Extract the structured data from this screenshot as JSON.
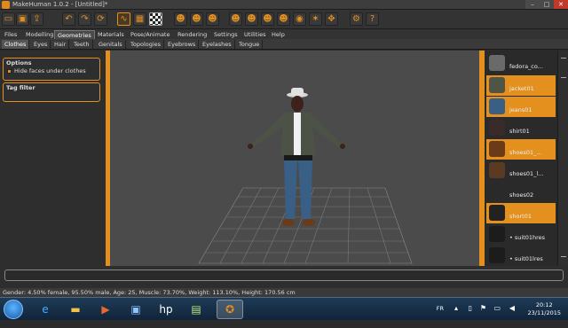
{
  "window": {
    "title": "MakeHuman 1.0.2 - [Untitled]*",
    "minimize": "–",
    "maximize": "□",
    "close": "✕"
  },
  "toolbar": {
    "icons": [
      {
        "name": "undo-icon",
        "glyph": "↶"
      },
      {
        "name": "redo-icon",
        "glyph": "↷"
      },
      {
        "name": "reset-icon",
        "glyph": "⟳"
      },
      {
        "name": "smooth-icon",
        "glyph": "∿"
      },
      {
        "name": "wireframe-icon",
        "glyph": "▦"
      },
      {
        "name": "background-checker-icon",
        "glyph": ""
      },
      {
        "name": "front-view-icon",
        "glyph": "☻"
      },
      {
        "name": "back-view-icon",
        "glyph": "☻"
      },
      {
        "name": "left-view-icon",
        "glyph": "☻"
      },
      {
        "name": "right-view-icon",
        "glyph": "☻"
      },
      {
        "name": "top-view-icon",
        "glyph": "☻"
      },
      {
        "name": "bottom-view-icon",
        "glyph": "☻"
      },
      {
        "name": "reset-camera-icon",
        "glyph": "✥"
      },
      {
        "name": "save-icon",
        "glyph": "▣"
      },
      {
        "name": "load-icon",
        "glyph": "▤"
      },
      {
        "name": "export-icon",
        "glyph": "⇪"
      },
      {
        "name": "screenshot-icon",
        "glyph": "◉"
      },
      {
        "name": "pose-icon",
        "glyph": "☼"
      },
      {
        "name": "skeleton-icon",
        "glyph": "✶"
      },
      {
        "name": "settings-icon",
        "glyph": "⚙"
      },
      {
        "name": "help-icon",
        "glyph": "?"
      }
    ]
  },
  "menu": {
    "tabs": [
      "Files",
      "Modelling",
      "Geometries",
      "Materials",
      "Pose/Animate",
      "Rendering",
      "Settings",
      "Utilities",
      "Help"
    ],
    "active": "Geometries"
  },
  "submenu": {
    "tabs": [
      "Clothes",
      "Eyes",
      "Hair",
      "Teeth",
      "Genitals",
      "Topologies",
      "Eyebrows",
      "Eyelashes",
      "Tongue"
    ],
    "active": "Clothes"
  },
  "left": {
    "options_title": "Options",
    "hide_faces_label": "Hide faces under clothes",
    "tag_filter_title": "Tag filter"
  },
  "clothes": {
    "items": [
      {
        "label": "fedora_co...",
        "selected": false,
        "color": "#6a6a6a"
      },
      {
        "label": "jacket01",
        "selected": true,
        "color": "#4f5546"
      },
      {
        "label": "jeans01",
        "selected": true,
        "color": "#3a5f86"
      },
      {
        "label": "shirt01",
        "selected": false,
        "color": "#3b2a2a"
      },
      {
        "label": "shoes01_...",
        "selected": true,
        "color": "#6b3a18"
      },
      {
        "label": "shoes01_l...",
        "selected": false,
        "color": "#5a3a22"
      },
      {
        "label": "shoes02",
        "selected": false,
        "color": "#2a2a2a"
      },
      {
        "label": "short01",
        "selected": true,
        "color": "#222222"
      },
      {
        "label": "• suit01hres",
        "selected": false,
        "color": "#1c1c1c"
      },
      {
        "label": "• suit01lres",
        "selected": false,
        "color": "#1c1c1c"
      }
    ]
  },
  "status": {
    "text": "Gender: 4.50% female, 95.50% male, Age: 25, Muscle: 73.70%, Weight: 113.10%, Height: 170.56 cm"
  },
  "taskbar": {
    "language": "FR",
    "time": "20:12",
    "date": "23/11/2015"
  },
  "colors": {
    "accent": "#e3901f",
    "viewport": "#4b4b4b"
  }
}
